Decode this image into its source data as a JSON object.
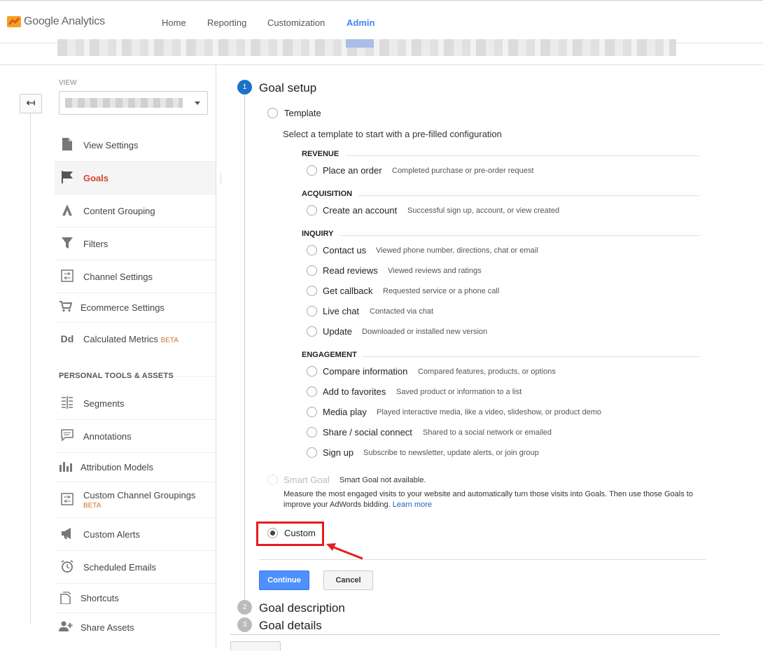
{
  "header": {
    "brand": "Google Analytics",
    "nav": [
      {
        "label": "Home"
      },
      {
        "label": "Reporting"
      },
      {
        "label": "Customization"
      },
      {
        "label": "Admin",
        "active": true
      }
    ]
  },
  "sidebar": {
    "view_label": "VIEW",
    "items": [
      {
        "label": "View Settings",
        "icon": "document-icon"
      },
      {
        "label": "Goals",
        "icon": "flag-icon",
        "active": true
      },
      {
        "label": "Content Grouping",
        "icon": "content-grouping-icon"
      },
      {
        "label": "Filters",
        "icon": "filter-icon"
      },
      {
        "label": "Channel Settings",
        "icon": "channel-settings-icon"
      },
      {
        "label": "Ecommerce Settings",
        "icon": "cart-icon"
      },
      {
        "label": "Calculated Metrics",
        "icon": "dd-icon",
        "badge": "BETA"
      }
    ],
    "tools_heading": "PERSONAL TOOLS & ASSETS",
    "tools": [
      {
        "label": "Segments",
        "icon": "segments-icon"
      },
      {
        "label": "Annotations",
        "icon": "annotation-icon"
      },
      {
        "label": "Attribution Models",
        "icon": "bar-chart-icon"
      },
      {
        "label": "Custom Channel Groupings",
        "icon": "channel-settings-icon",
        "badge": "BETA"
      },
      {
        "label": "Custom Alerts",
        "icon": "megaphone-icon"
      },
      {
        "label": "Scheduled Emails",
        "icon": "alarm-clock-icon"
      },
      {
        "label": "Shortcuts",
        "icon": "copy-icon"
      },
      {
        "label": "Share Assets",
        "icon": "add-person-icon"
      }
    ]
  },
  "goal": {
    "steps": [
      {
        "num": "1",
        "title": "Goal setup"
      },
      {
        "num": "2",
        "title": "Goal description"
      },
      {
        "num": "3",
        "title": "Goal details"
      }
    ],
    "template_label": "Template",
    "template_desc": "Select a template to start with a pre-filled configuration",
    "categories": [
      {
        "name": "REVENUE",
        "options": [
          {
            "name": "Place an order",
            "desc": "Completed purchase or pre-order request"
          }
        ]
      },
      {
        "name": "ACQUISITION",
        "options": [
          {
            "name": "Create an account",
            "desc": "Successful sign up, account, or view created"
          }
        ]
      },
      {
        "name": "INQUIRY",
        "options": [
          {
            "name": "Contact us",
            "desc": "Viewed phone number, directions, chat or email"
          },
          {
            "name": "Read reviews",
            "desc": "Viewed reviews and ratings"
          },
          {
            "name": "Get callback",
            "desc": "Requested service or a phone call"
          },
          {
            "name": "Live chat",
            "desc": "Contacted via chat"
          },
          {
            "name": "Update",
            "desc": "Downloaded or installed new version"
          }
        ]
      },
      {
        "name": "ENGAGEMENT",
        "options": [
          {
            "name": "Compare information",
            "desc": "Compared features, products, or options"
          },
          {
            "name": "Add to favorites",
            "desc": "Saved product or information to a list"
          },
          {
            "name": "Media play",
            "desc": "Played interactive media, like a video, slideshow, or product demo"
          },
          {
            "name": "Share / social connect",
            "desc": "Shared to a social network or emailed"
          },
          {
            "name": "Sign up",
            "desc": "Subscribe to newsletter, update alerts, or join group"
          }
        ]
      }
    ],
    "smart_label": "Smart Goal",
    "smart_status": "Smart Goal not available.",
    "smart_desc_1": "Measure the most engaged visits to your website and automatically turn those visits into Goals. Then use those Goals to",
    "smart_desc_2": "improve your AdWords bidding.",
    "learn_more": "Learn more",
    "custom_label": "Custom",
    "continue_label": "Continue",
    "cancel_label": "Cancel",
    "highlight_color": "#e21e1e",
    "accent_color": "#4285f4"
  }
}
